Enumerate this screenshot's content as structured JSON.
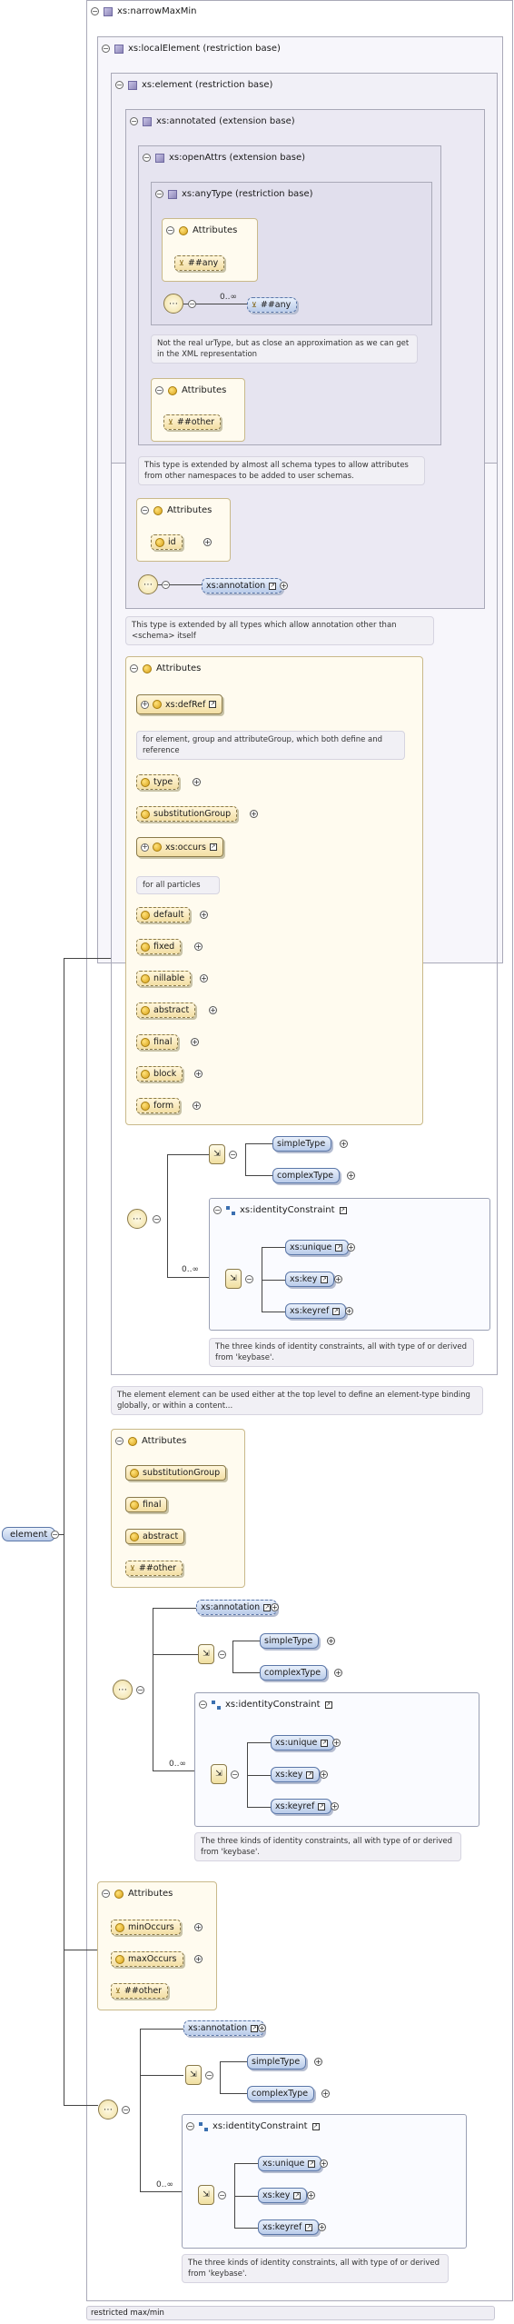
{
  "root": {
    "title": "xs:narrowMaxMin",
    "local_element": "xs:localElement (restriction base)",
    "element": "xs:element (restriction base)",
    "annotated": "xs:annotated (extension base)",
    "open_attrs": "xs:openAttrs (extension base)",
    "any_type": "xs:anyType (restriction base)"
  },
  "any_type": {
    "attributes_label": "Attributes",
    "any_attr": "##any",
    "occurs": "0..∞",
    "any_elem": "##any",
    "note": "Not the real urType, but as close an approximation as we can get in the XML representation"
  },
  "open_attrs": {
    "attributes_label": "Attributes",
    "other": "##other",
    "note": "This type is extended by almost all schema types to allow attributes from other namespaces to be added to user schemas."
  },
  "annotated": {
    "attributes_label": "Attributes",
    "id": "id",
    "annotation": "xs:annotation",
    "note": "This type is extended by all types which allow annotation other than <schema> itself"
  },
  "element_attrs": {
    "label": "Attributes",
    "defref": "xs:defRef",
    "defref_note": "for element, group and attributeGroup, which both define and reference",
    "type": "type",
    "substitution": "substitutionGroup",
    "occurs_group": "xs:occurs",
    "occurs_note": "for all particles",
    "default": "default",
    "fixed": "fixed",
    "nillable": "nillable",
    "abstract": "abstract",
    "final": "final",
    "block": "block",
    "form": "form"
  },
  "element_content": {
    "simple": "simpleType",
    "complex": "complexType",
    "identity": "xs:identityConstraint",
    "unique": "xs:unique",
    "key": "xs:key",
    "keyref": "xs:keyref",
    "occurs": "0..∞",
    "identity_note": "The three kinds of identity constraints, all with type of or derived from 'keybase'.",
    "element_note": "The element element can be used either at the top level to define an element-type binding globally, or within a content..."
  },
  "local_attrs": {
    "label": "Attributes",
    "substitution": "substitutionGroup",
    "final": "final",
    "abstract": "abstract",
    "other": "##other"
  },
  "local_content": {
    "annotation": "xs:annotation",
    "simple": "simpleType",
    "complex": "complexType",
    "identity": "xs:identityConstraint",
    "unique": "xs:unique",
    "key": "xs:key",
    "keyref": "xs:keyref",
    "occurs": "0..∞",
    "identity_note": "The three kinds of identity constraints, all with type of or derived from 'keybase'."
  },
  "narrow_attrs": {
    "label": "Attributes",
    "min": "minOccurs",
    "max": "maxOccurs",
    "other": "##other"
  },
  "narrow_content": {
    "annotation": "xs:annotation",
    "simple": "simpleType",
    "complex": "complexType",
    "identity": "xs:identityConstraint",
    "unique": "xs:unique",
    "key": "xs:key",
    "keyref": "xs:keyref",
    "occurs": "0..∞",
    "identity_note": "The three kinds of identity constraints, all with type of or derived from 'keybase'."
  },
  "root_element": "element",
  "footer": "restricted max/min"
}
